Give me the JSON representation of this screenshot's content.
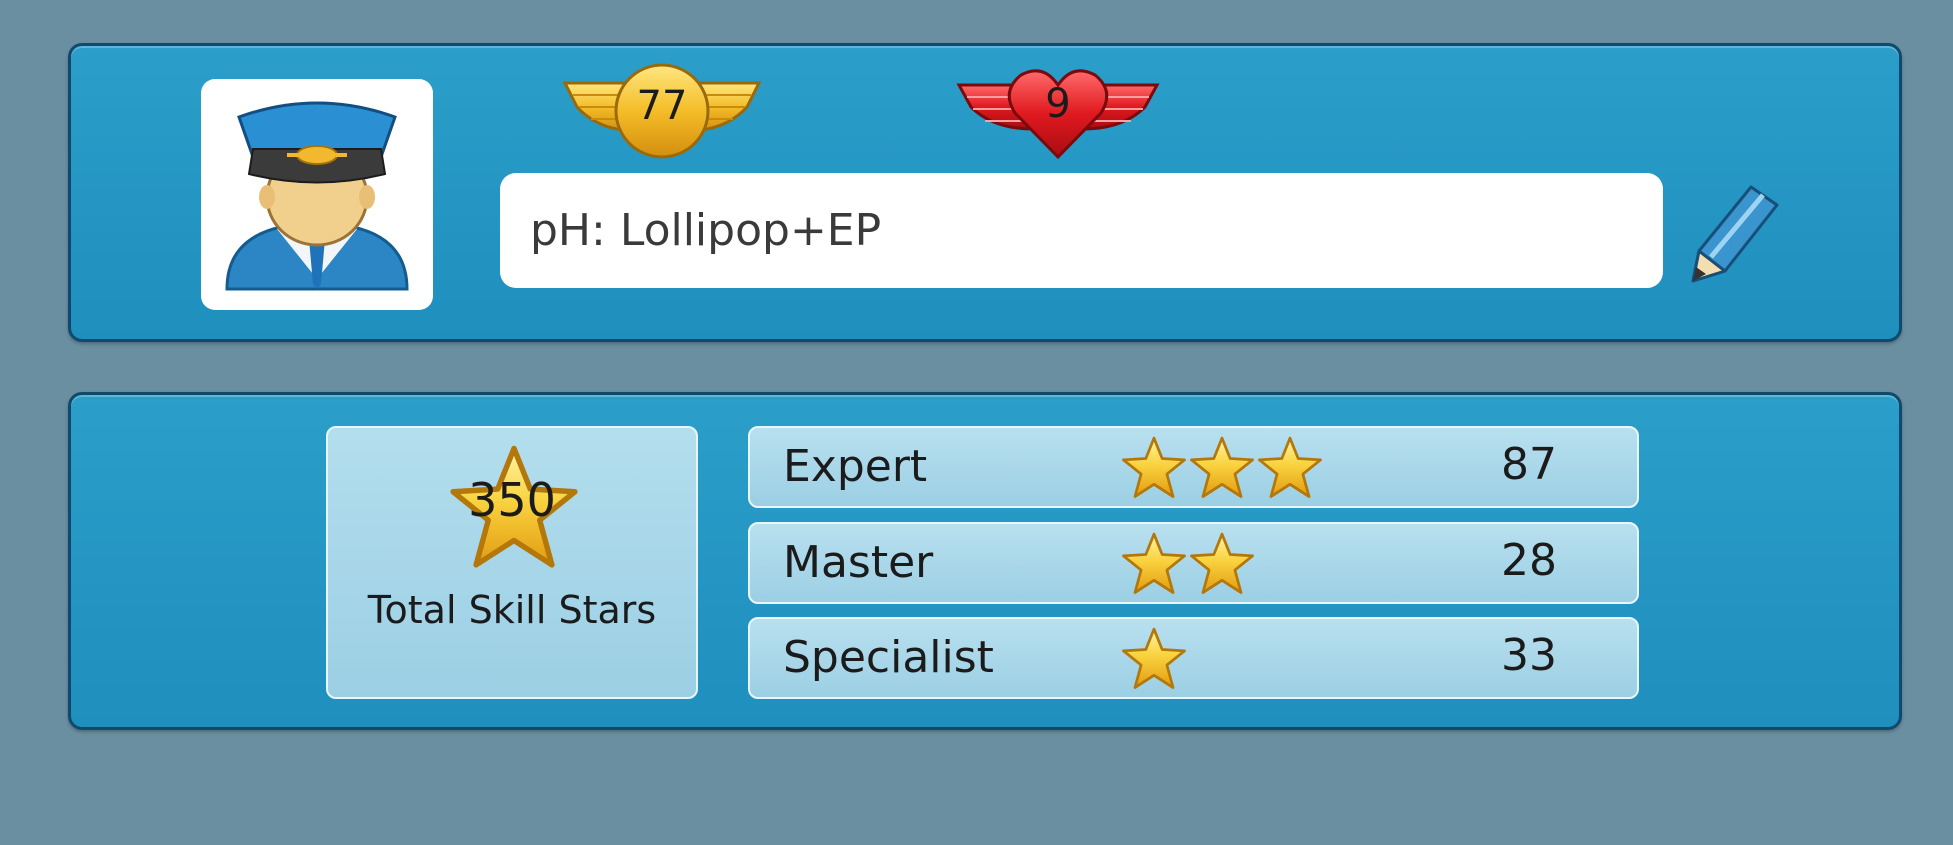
{
  "profile": {
    "avatar_icon": "pilot-avatar-icon",
    "level": "77",
    "hearts": "9",
    "name": "pH: Lollipop+EP",
    "edit_icon": "pencil-icon"
  },
  "skills": {
    "total_value": "350",
    "total_label": "Total Skill Stars",
    "ranks": [
      {
        "name": "Expert",
        "stars": 3,
        "count": "87"
      },
      {
        "name": "Master",
        "stars": 2,
        "count": "28"
      },
      {
        "name": "Specialist",
        "stars": 1,
        "count": "33"
      }
    ]
  },
  "colors": {
    "background": "#6a8fa1",
    "panel": "#2498c5",
    "panel_border": "#0f4a6e",
    "row_fill": "#a8d8ea",
    "star_gold": "#f6c531",
    "heart_red": "#d9161c"
  }
}
